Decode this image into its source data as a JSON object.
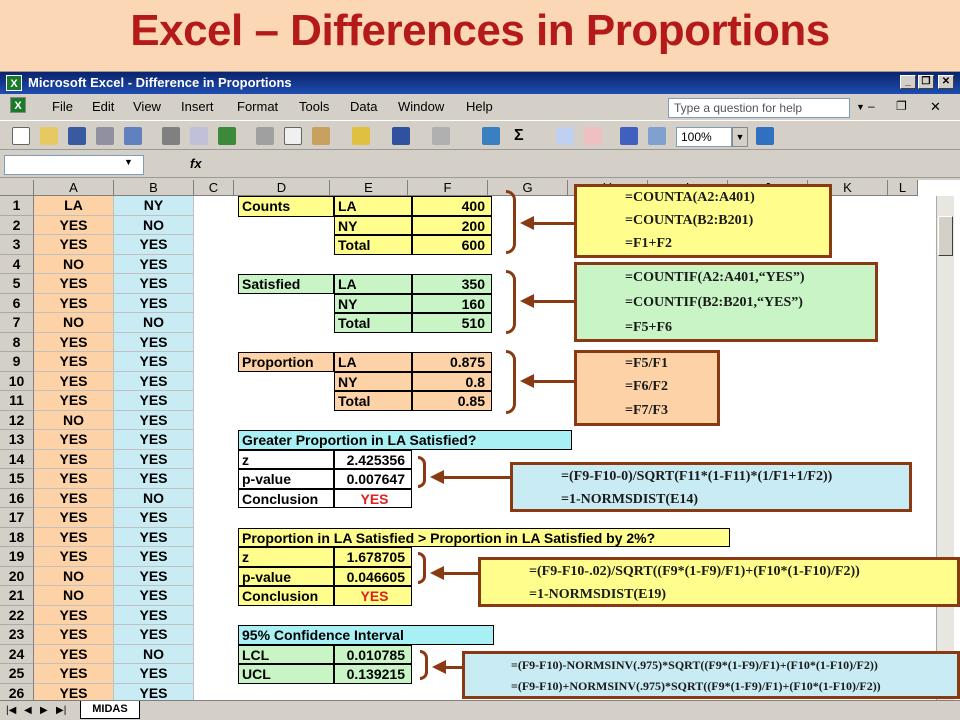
{
  "slide_title": "Excel – Differences in Proportions",
  "window": {
    "title": "Microsoft Excel - Difference in Proportions",
    "logo": "X"
  },
  "menu": {
    "items": [
      "File",
      "Edit",
      "View",
      "Insert",
      "Format",
      "Tools",
      "Data",
      "Window",
      "Help"
    ],
    "ask_placeholder": "Type a question for help"
  },
  "toolbar": {
    "zoom": "100%"
  },
  "formula_bar": {
    "fx": "fx"
  },
  "columns": [
    "A",
    "B",
    "C",
    "D",
    "E",
    "F",
    "G",
    "H",
    "I",
    "J",
    "K",
    "L"
  ],
  "rows": [
    {
      "n": "1",
      "a": "LA",
      "b": "NY"
    },
    {
      "n": "2",
      "a": "YES",
      "b": "NO"
    },
    {
      "n": "3",
      "a": "YES",
      "b": "YES"
    },
    {
      "n": "4",
      "a": "NO",
      "b": "YES"
    },
    {
      "n": "5",
      "a": "YES",
      "b": "YES"
    },
    {
      "n": "6",
      "a": "YES",
      "b": "YES"
    },
    {
      "n": "7",
      "a": "NO",
      "b": "NO"
    },
    {
      "n": "8",
      "a": "YES",
      "b": "YES"
    },
    {
      "n": "9",
      "a": "YES",
      "b": "YES"
    },
    {
      "n": "10",
      "a": "YES",
      "b": "YES"
    },
    {
      "n": "11",
      "a": "YES",
      "b": "YES"
    },
    {
      "n": "12",
      "a": "NO",
      "b": "YES"
    },
    {
      "n": "13",
      "a": "YES",
      "b": "YES"
    },
    {
      "n": "14",
      "a": "YES",
      "b": "YES"
    },
    {
      "n": "15",
      "a": "YES",
      "b": "YES"
    },
    {
      "n": "16",
      "a": "YES",
      "b": "NO"
    },
    {
      "n": "17",
      "a": "YES",
      "b": "YES"
    },
    {
      "n": "18",
      "a": "YES",
      "b": "YES"
    },
    {
      "n": "19",
      "a": "YES",
      "b": "YES"
    },
    {
      "n": "20",
      "a": "NO",
      "b": "YES"
    },
    {
      "n": "21",
      "a": "NO",
      "b": "YES"
    },
    {
      "n": "22",
      "a": "YES",
      "b": "YES"
    },
    {
      "n": "23",
      "a": "YES",
      "b": "YES"
    },
    {
      "n": "24",
      "a": "YES",
      "b": "NO"
    },
    {
      "n": "25",
      "a": "YES",
      "b": "YES"
    },
    {
      "n": "26",
      "a": "YES",
      "b": "YES"
    }
  ],
  "counts": {
    "label": "Counts",
    "r1": [
      "LA",
      "400"
    ],
    "r2": [
      "NY",
      "200"
    ],
    "r3": [
      "Total",
      "600"
    ]
  },
  "satisfied": {
    "label": "Satisfied",
    "r1": [
      "LA",
      "350"
    ],
    "r2": [
      "NY",
      "160"
    ],
    "r3": [
      "Total",
      "510"
    ]
  },
  "proportion": {
    "label": "Proportion",
    "r1": [
      "LA",
      "0.875"
    ],
    "r2": [
      "NY",
      "0.8"
    ],
    "r3": [
      "Total",
      "0.85"
    ]
  },
  "test1": {
    "header": "Greater Proportion in LA Satisfied?",
    "z": [
      "z",
      "2.425356"
    ],
    "p": [
      "p-value",
      "0.007647"
    ],
    "c": [
      "Conclusion",
      "YES"
    ]
  },
  "test2": {
    "header": "Proportion in LA Satisfied > Proportion in LA Satisfied by 2%?",
    "z": [
      "z",
      "1.678705"
    ],
    "p": [
      "p-value",
      "0.046605"
    ],
    "c": [
      "Conclusion",
      "YES"
    ]
  },
  "ci": {
    "header": "95% Confidence Interval",
    "lcl": [
      "LCL",
      "0.010785"
    ],
    "ucl": [
      "UCL",
      "0.139215"
    ]
  },
  "callouts": {
    "counts": [
      "=COUNTA(A2:A401)",
      "=COUNTA(B2:B201)",
      "=F1+F2"
    ],
    "satisfied": [
      "=COUNTIF(A2:A401,“YES”)",
      "=COUNTIF(B2:B201,“YES”)",
      "=F5+F6"
    ],
    "proportion": [
      "=F5/F1",
      "=F6/F2",
      "=F7/F3"
    ],
    "test1": [
      "=(F9-F10-0)/SQRT(F11*(1-F11)*(1/F1+1/F2))",
      "=1-NORMSDIST(E14)"
    ],
    "test2": [
      "=(F9-F10-.02)/SQRT((F9*(1-F9)/F1)+(F10*(1-F10)/F2))",
      "=1-NORMSDIST(E19)"
    ],
    "ci": [
      "=(F9-F10)-NORMSINV(.975)*SQRT((F9*(1-F9)/F1)+(F10*(1-F10)/F2))",
      "=(F9-F10)+NORMSINV(.975)*SQRT((F9*(1-F9)/F1)+(F10*(1-F10)/F2))"
    ]
  },
  "sheet_tab": "MIDAS"
}
